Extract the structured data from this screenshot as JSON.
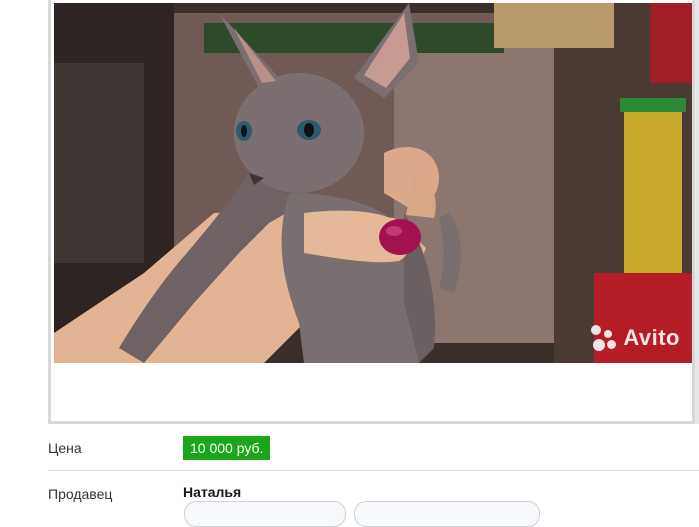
{
  "photo": {
    "watermark_text": "Avito"
  },
  "details": {
    "price_label": "Цена",
    "price_value": "10 000 руб.",
    "seller_label": "Продавец",
    "seller_name": "Наталья"
  },
  "colors": {
    "price_badge": "#1aa51a",
    "frame_border": "#d9d9d9"
  }
}
